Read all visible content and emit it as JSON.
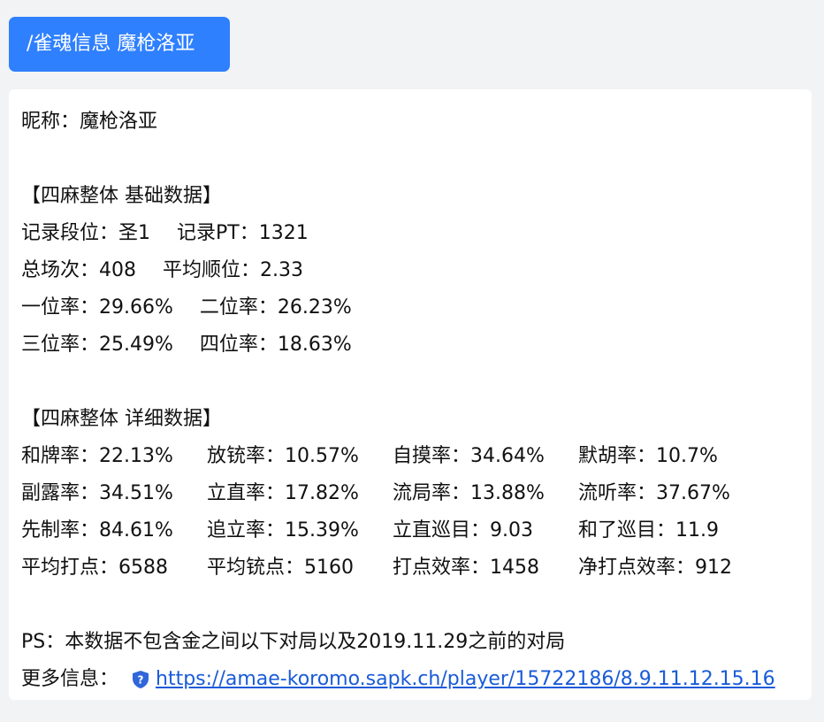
{
  "command": "/雀魂信息 魔枪洛亚",
  "nickname_line": "昵称：魔枪洛亚",
  "basic": {
    "header": "【四麻整体 基础数据】",
    "rank": "记录段位：圣1",
    "pt": "记录PT：1321",
    "games": "总场次：408",
    "avg_place": "平均顺位：2.33",
    "first_rate": "一位率：29.66%",
    "second_rate": "二位率：26.23%",
    "third_rate": "三位率：25.49%",
    "fourth_rate": "四位率：18.63%"
  },
  "detail": {
    "header": "【四麻整体 详细数据】",
    "rows": [
      [
        "和牌率：22.13%",
        "放铳率：10.57%",
        "自摸率：34.64%",
        "默胡率：10.7%"
      ],
      [
        "副露率：34.51%",
        "立直率：17.82%",
        "流局率：13.88%",
        "流听率：37.67%"
      ],
      [
        "先制率：84.61%",
        "追立率：15.39%",
        "立直巡目：9.03",
        "和了巡目：11.9"
      ],
      [
        "平均打点：6588",
        "平均铳点：5160",
        "打点效率：1458",
        "净打点效率：912"
      ]
    ]
  },
  "ps": "PS：本数据不包含金之间以下对局以及2019.11.29之前的对局",
  "more_info": {
    "label": "更多信息：",
    "link_text": "https://amae-koromo.sapk.ch/player/15722186/8.9.11.12.15.16",
    "icon": "shield-question-icon"
  },
  "colors": {
    "bubble": "#2f80ff",
    "link": "#1a5bd8",
    "background": "#f2f3f5"
  }
}
